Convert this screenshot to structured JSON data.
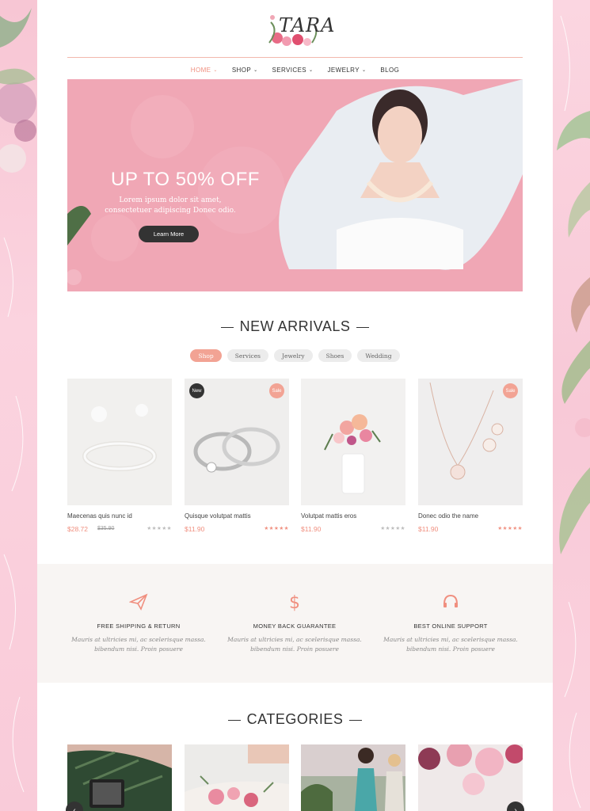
{
  "brand": {
    "logo_text": "TARA"
  },
  "nav": {
    "items": [
      {
        "label": "HOME",
        "active": true,
        "dropdown": true
      },
      {
        "label": "SHOP",
        "active": false,
        "dropdown": true
      },
      {
        "label": "SERVICES",
        "active": false,
        "dropdown": true
      },
      {
        "label": "JEWELRY",
        "active": false,
        "dropdown": true
      },
      {
        "label": "BLOG",
        "active": false,
        "dropdown": false
      }
    ]
  },
  "hero": {
    "title": "UP TO 50% OFF",
    "subtitle": "Lorem ipsum dolor sit amet, consectetuer adipiscing Donec odio.",
    "button": "Learn More"
  },
  "new_arrivals": {
    "title": "NEW ARRIVALS",
    "filters": [
      "Shop",
      "Services",
      "Jewelry",
      "Shoes",
      "Wedding"
    ],
    "active_filter": "Shop",
    "products": [
      {
        "name": "Maecenas quis nunc id",
        "price": "$28.72",
        "old_price": "$35.90",
        "badge": "",
        "rating": 0
      },
      {
        "name": "Quisque volutpat mattis",
        "price": "$11.90",
        "old_price": "",
        "badge": "New",
        "badge2": "Sale",
        "rating": 5
      },
      {
        "name": "Volutpat mattis eros",
        "price": "$11.90",
        "old_price": "",
        "badge": "",
        "rating": 0
      },
      {
        "name": "Donec odio the name",
        "price": "$11.90",
        "old_price": "",
        "badge": "Sale",
        "rating": 5
      }
    ]
  },
  "features": [
    {
      "icon": "paper-plane-icon",
      "title": "FREE SHIPPING & RETURN",
      "desc": "Mauris at ultricies mi, ac scelerisque massa. bibendum nisi. Proin posuere"
    },
    {
      "icon": "dollar-icon",
      "title": "MONEY BACK GUARANTEE",
      "desc": "Mauris at ultricies mi, ac scelerisque massa. bibendum nisi. Proin posuere"
    },
    {
      "icon": "headset-icon",
      "title": "BEST ONLINE SUPPORT",
      "desc": "Mauris at ultricies mi, ac scelerisque massa. bibendum nisi. Proin posuere"
    }
  ],
  "categories": {
    "title": "CATEGORIES"
  },
  "colors": {
    "accent": "#f08f7f",
    "pink": "#f0a7b5",
    "dark": "#333333"
  }
}
